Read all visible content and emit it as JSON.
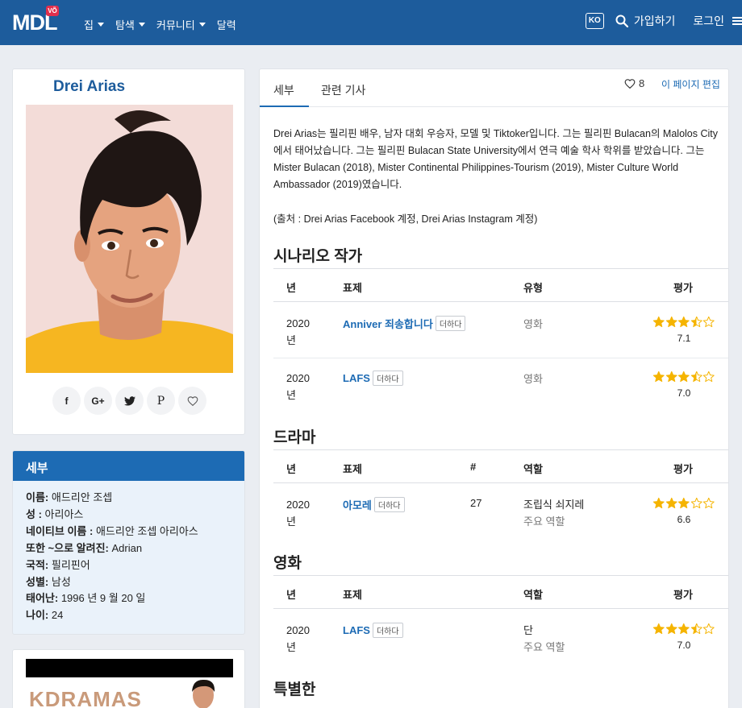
{
  "nav": {
    "logo": "MDL",
    "logo_badge": "VÕ",
    "menu": [
      "집",
      "탐색",
      "커뮤니티",
      "달력"
    ],
    "lang": "KO",
    "signup": "가입하기",
    "login": "로그인"
  },
  "profile": {
    "name": "Drei Arias"
  },
  "details": {
    "header": "세부",
    "items": [
      {
        "label": "이름:",
        "value": " 애드리안 조셉"
      },
      {
        "label": "성 :",
        "value": " 아리아스"
      },
      {
        "label": "네이티브 이름 :",
        "value": " 애드리안 조셉 아리아스"
      },
      {
        "label": "또한 ~으로 알려진:",
        "value": " Adrian"
      },
      {
        "label": "국적:",
        "value": " 필리핀어"
      },
      {
        "label": "성별:",
        "value": " 남성"
      },
      {
        "label": "태어난:",
        "value": " 1996 년 9 월 20 일"
      },
      {
        "label": "나이:",
        "value": " 24"
      }
    ]
  },
  "ad": {
    "text": "KDRAMAS"
  },
  "tabs": {
    "details": "세부",
    "articles": "관련 기사",
    "likes": "8",
    "edit": "이 페이지 편집"
  },
  "bio": {
    "text": "Drei Arias는 필리핀 배우, 남자 대회 우승자, 모델 및 Tiktoker입니다. 그는 필리핀 Bulacan의 Malolos City에서 태어났습니다. 그는 필리핀 Bulacan State University에서 연극 예술 학사 학위를 받았습니다. 그는 Mister Bulacan (2018), Mister Continental Philippines-Tourism (2019), Mister Culture World Ambassador (2019)였습니다.",
    "source": "(출처 : Drei Arias Facebook 계정, Drei Arias Instagram 계정)"
  },
  "sections": {
    "screenwriter": {
      "title": "시나리오 작가",
      "headers": {
        "year": "년",
        "title": "표제",
        "type": "유형",
        "rating": "평가"
      },
      "rows": [
        {
          "year": "2020 년",
          "title": "Anniver 죄송합니다",
          "add": "더하다",
          "type": "영화",
          "stars": 3.5,
          "score": "7.1"
        },
        {
          "year": "2020 년",
          "title": "LAFS",
          "add": "더하다",
          "type": "영화",
          "stars": 3.5,
          "score": "7.0"
        }
      ]
    },
    "drama": {
      "title": "드라마",
      "headers": {
        "year": "년",
        "title": "표제",
        "ep": "#",
        "role": "역할",
        "rating": "평가"
      },
      "rows": [
        {
          "year": "2020 년",
          "title": "아모레",
          "add": "더하다",
          "ep": "27",
          "role": "조립식 쇠지레",
          "role_sub": "주요 역할",
          "stars": 3,
          "score": "6.6"
        }
      ]
    },
    "movie": {
      "title": "영화",
      "headers": {
        "year": "년",
        "title": "표제",
        "role": "역할",
        "rating": "평가"
      },
      "rows": [
        {
          "year": "2020 년",
          "title": "LAFS",
          "add": "더하다",
          "role": "단",
          "role_sub": "주요 역할",
          "stars": 3.5,
          "score": "7.0"
        }
      ]
    },
    "special": {
      "title": "특별한"
    }
  },
  "colors": {
    "brand": "#1d5c9c",
    "accent": "#1d6bb4",
    "star": "#f5b400"
  }
}
